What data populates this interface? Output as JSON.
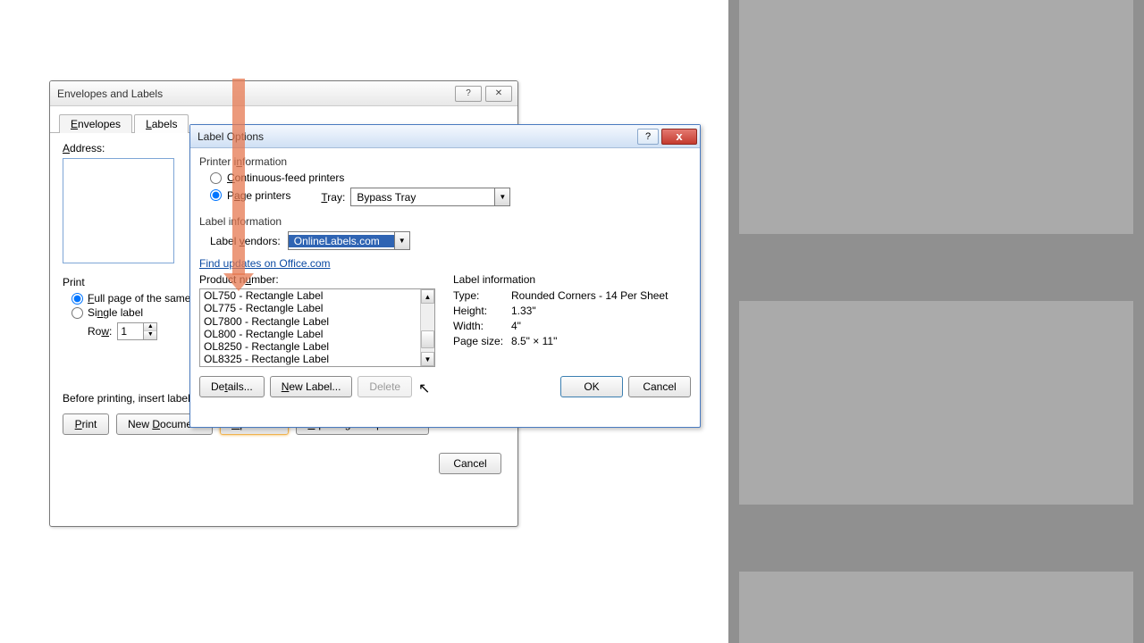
{
  "dlg1": {
    "title": "Envelopes and Labels",
    "tabs": {
      "envelopes": "Envelopes",
      "labels": "Labels"
    },
    "address_label": "Address:",
    "print_label": "Print",
    "full_page": "Full page of the same label",
    "single_label": "Single label",
    "row_label": "Row:",
    "row_value": "1",
    "note": "Before printing, insert labels in your printer's manual feeder.",
    "buttons": {
      "print": "Print",
      "new_document": "New Document",
      "options": "Options...",
      "epostage": "E-postage Properties...",
      "cancel": "Cancel"
    }
  },
  "dlg2": {
    "title": "Label Options",
    "printer_info": "Printer information",
    "continuous": "Continuous-feed printers",
    "page_printers": "Page printers",
    "tray_label": "Tray:",
    "tray_value": "Bypass Tray",
    "label_info": "Label information",
    "vendors_label": "Label vendors:",
    "vendors_value": "OnlineLabels.com",
    "updates_link": "Find updates on Office.com",
    "product_label": "Product number:",
    "products": [
      "OL750 - Rectangle Label",
      "OL775 - Rectangle Label",
      "OL7800 - Rectangle Label",
      "OL800 - Rectangle Label",
      "OL8250 - Rectangle Label",
      "OL8325 - Rectangle Label"
    ],
    "right_header": "Label information",
    "type_label": "Type:",
    "type_value": "Rounded Corners - 14 Per Sheet",
    "height_label": "Height:",
    "height_value": "1.33\"",
    "width_label": "Width:",
    "width_value": "4\"",
    "pagesize_label": "Page size:",
    "pagesize_value": "8.5\" × 11\"",
    "buttons": {
      "details": "Details...",
      "new_label": "New Label...",
      "delete": "Delete",
      "ok": "OK",
      "cancel": "Cancel"
    }
  }
}
